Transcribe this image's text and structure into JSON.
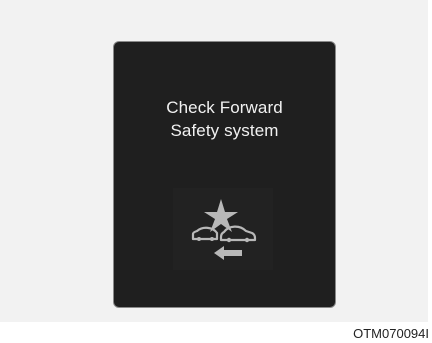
{
  "warning": {
    "line1": "Check Forward",
    "line2": "Safety system",
    "icon": "forward-collision-warning-icon"
  },
  "figure_code": "OTM070094I",
  "colors": {
    "display_background": "#1f1f1f",
    "text": "#f1f1f1",
    "icon": "#b8b8b8"
  }
}
